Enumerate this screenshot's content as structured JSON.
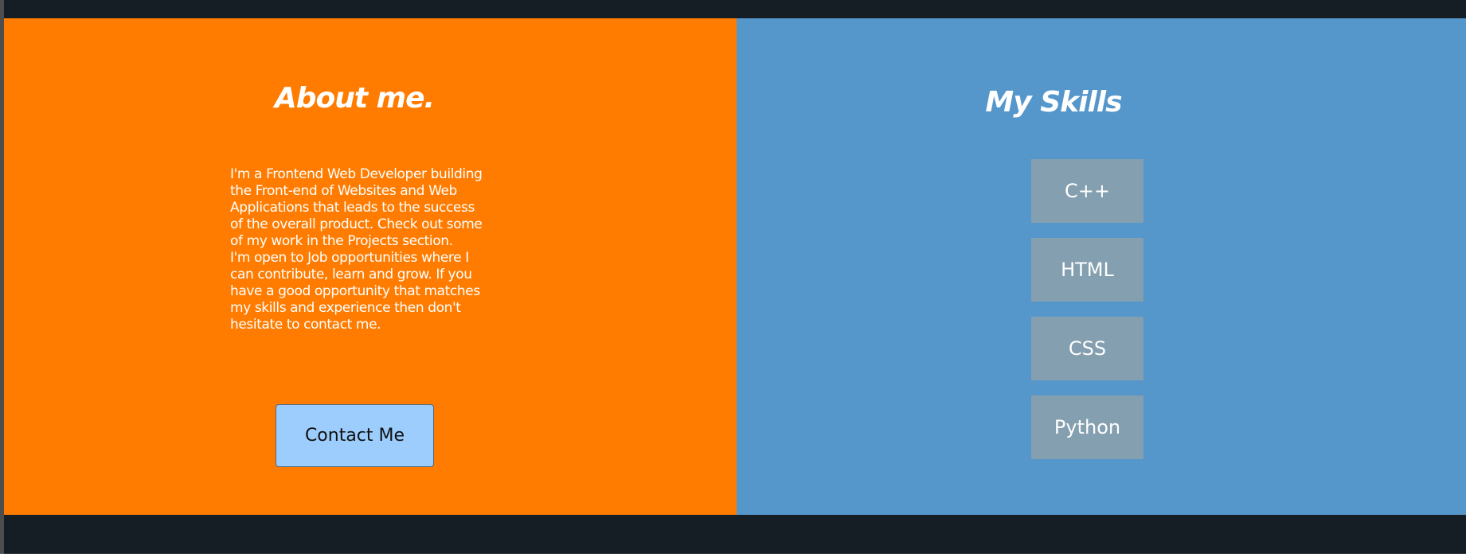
{
  "about": {
    "title": "About me.",
    "paragraphs": [
      "I'm a Frontend Web Developer building the Front-end of Websites and Web Applications that leads to the success of the overall product. Check out some of my work in the Projects section.",
      "I'm open to Job opportunities where I can contribute, learn and grow. If you have a good opportunity that matches my skills and experience then don't hesitate to contact me."
    ],
    "contact_label": "Contact Me"
  },
  "skills": {
    "title": "My Skills",
    "items": [
      "C++",
      "HTML",
      "CSS",
      "Python"
    ]
  },
  "colors": {
    "about_bg": "#ff7c00",
    "skills_bg": "#5596cb",
    "frame_bg": "#151d25",
    "button_bg": "#9ccdfc",
    "skill_chip_bg": "#849faf"
  }
}
